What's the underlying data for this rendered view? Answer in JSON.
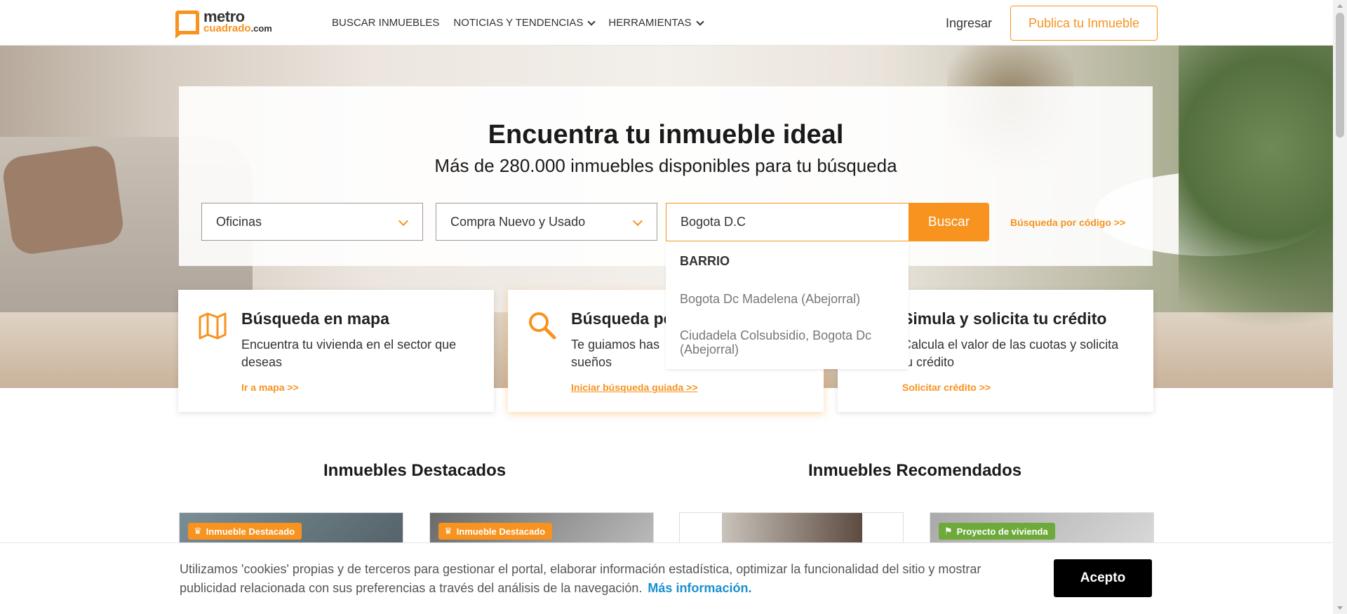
{
  "header": {
    "logo_line1": "metro",
    "logo_line2": "cuadrado",
    "logo_domain": ".com",
    "nav": [
      {
        "label": "BUSCAR INMUEBLES"
      },
      {
        "label": "NOTICIAS Y TENDENCIAS"
      },
      {
        "label": "HERRAMIENTAS"
      }
    ],
    "login": "Ingresar",
    "publish": "Publica tu Inmueble"
  },
  "hero": {
    "title": "Encuentra tu inmueble ideal",
    "subtitle": "Más de 280.000 inmuebles disponibles para tu búsqueda",
    "property_type": "Oficinas",
    "operation": "Compra Nuevo y Usado",
    "location_value": "Bogota D.C",
    "search_button": "Buscar",
    "code_search": "Búsqueda por código  >>"
  },
  "dropdown": {
    "header": "BARRIO",
    "items": [
      "Bogota Dc Madelena (Abejorral)",
      "Ciudadela Colsubsidio, Bogota Dc (Abejorral)"
    ]
  },
  "cards": [
    {
      "title": "Búsqueda en mapa",
      "desc": "Encuentra tu vivienda en el sector que deseas",
      "link": "Ir a mapa  >>"
    },
    {
      "title": "Búsqueda pe",
      "desc": "Te guiamos has sueños",
      "link": "Iniciar búsqueda guiada  >>"
    },
    {
      "title": "Simula y solicita tu crédito",
      "desc": "Calcula el valor de las cuotas y solicita tu crédito",
      "link": "Solicitar crédito  >>"
    }
  ],
  "sections": {
    "featured": "Inmuebles Destacados",
    "recommended": "Inmuebles Recomendados"
  },
  "tags": {
    "featured": "Inmueble Destacado",
    "project": "Proyecto de vivienda"
  },
  "cookie": {
    "text": "Utilizamos 'cookies' propias y de terceros para gestionar el portal, elaborar información estadística, optimizar la funcionalidad del sitio y mostrar publicidad relacionada con sus preferencias a través del análisis de la navegación.",
    "more": "Más información.",
    "accept": "Acepto"
  },
  "colors": {
    "accent": "#f7931e",
    "link": "#1a8fd0",
    "green_tag": "#6daa3b"
  }
}
